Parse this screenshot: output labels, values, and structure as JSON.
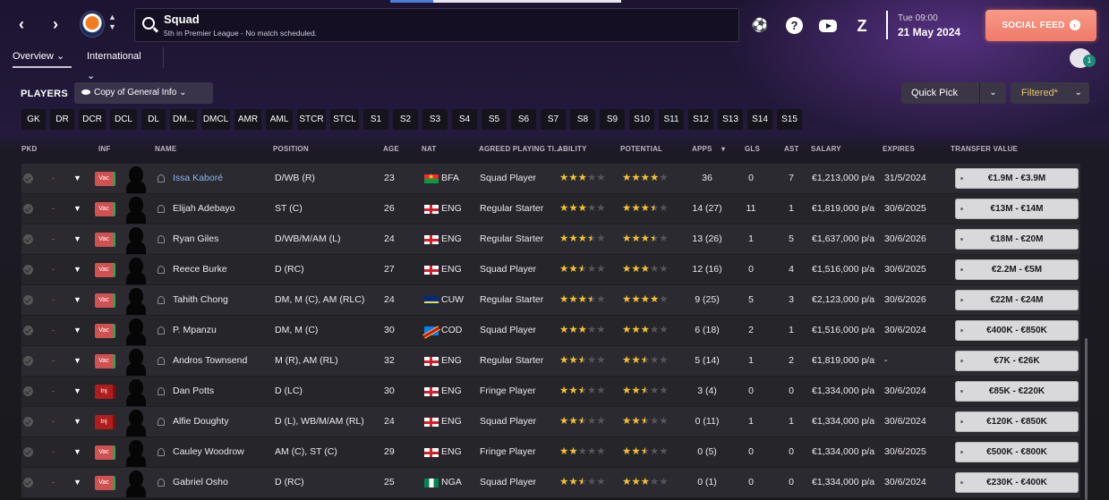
{
  "header": {
    "back_label": "‹",
    "forward_label": "›",
    "search_title": "Squad",
    "search_subtitle": "5th in Premier League - No match scheduled.",
    "date_day": "Tue 09:00",
    "date_full": "21 May 2024",
    "social_feed_label": "SOCIAL FEED"
  },
  "subnav": {
    "overview_label": "Overview",
    "international_label": "International",
    "user_badge": "1"
  },
  "players_bar": {
    "title": "PLAYERS",
    "view_label": "Copy of General Info",
    "quick_pick_label": "Quick Pick",
    "filtered_label": "Filtered*"
  },
  "position_filters": [
    "GK",
    "DR",
    "DCR",
    "DCL",
    "DL",
    "DM...",
    "DMCL",
    "AMR",
    "AML",
    "STCR",
    "STCL",
    "S1",
    "S2",
    "S3",
    "S4",
    "S5",
    "S6",
    "S7",
    "S8",
    "S9",
    "S10",
    "S11",
    "S12",
    "S13",
    "S14",
    "S15"
  ],
  "columns": {
    "pkd": "PKD",
    "inf": "INF",
    "name": "NAME",
    "position": "POSITION",
    "age": "AGE",
    "nat": "NAT",
    "agreed": "AGREED PLAYING TI...",
    "ability": "ABILITY",
    "potential": "POTENTIAL",
    "apps": "APPS",
    "gls": "GLS",
    "ast": "AST",
    "salary": "SALARY",
    "expires": "EXPIRES",
    "transfer_value": "TRANSFER VALUE"
  },
  "players": [
    {
      "name": "Issa Kaboré",
      "status": "Vac",
      "position": "D/WB (R)",
      "age": "23",
      "nat": "BFA",
      "flag": "bfa",
      "agreed": "Squad Player",
      "ability": 3,
      "potential": 4,
      "apps": "36",
      "gls": "0",
      "ast": "7",
      "salary": "€1,213,000 p/a",
      "expires": "31/5/2024",
      "value": "€1.9M - €3.9M"
    },
    {
      "name": "Elijah Adebayo",
      "status": "Vac",
      "position": "ST (C)",
      "age": "26",
      "nat": "ENG",
      "flag": "eng",
      "agreed": "Regular Starter",
      "ability": 3,
      "potential": 3.5,
      "apps": "14 (27)",
      "gls": "11",
      "ast": "1",
      "salary": "€1,819,000 p/a",
      "expires": "30/6/2025",
      "value": "€13M - €14M"
    },
    {
      "name": "Ryan Giles",
      "status": "Vac",
      "position": "D/WB/M/AM (L)",
      "age": "24",
      "nat": "ENG",
      "flag": "eng",
      "agreed": "Regular Starter",
      "ability": 3.5,
      "potential": 3.5,
      "apps": "13 (26)",
      "gls": "1",
      "ast": "5",
      "salary": "€1,637,000 p/a",
      "expires": "30/6/2026",
      "value": "€18M - €20M"
    },
    {
      "name": "Reece Burke",
      "status": "Vac",
      "position": "D (RC)",
      "age": "27",
      "nat": "ENG",
      "flag": "eng",
      "agreed": "Squad Player",
      "ability": 2.5,
      "potential": 3,
      "apps": "12 (16)",
      "gls": "0",
      "ast": "4",
      "salary": "€1,516,000 p/a",
      "expires": "30/6/2025",
      "value": "€2.2M - €5M"
    },
    {
      "name": "Tahith Chong",
      "status": "Vac",
      "position": "DM, M (C), AM (RLC)",
      "age": "24",
      "nat": "CUW",
      "flag": "cuw",
      "agreed": "Regular Starter",
      "ability": 3.5,
      "potential": 4,
      "apps": "9 (25)",
      "gls": "5",
      "ast": "3",
      "salary": "€2,123,000 p/a",
      "expires": "30/6/2026",
      "value": "€22M - €24M"
    },
    {
      "name": "P. Mpanzu",
      "status": "Vac",
      "position": "DM, M (C)",
      "age": "30",
      "nat": "COD",
      "flag": "cod",
      "agreed": "Squad Player",
      "ability": 3,
      "potential": 3,
      "apps": "6 (18)",
      "gls": "2",
      "ast": "1",
      "salary": "€1,516,000 p/a",
      "expires": "30/6/2024",
      "value": "€400K - €850K"
    },
    {
      "name": "Andros Townsend",
      "status": "Vac",
      "position": "M (R), AM (RL)",
      "age": "32",
      "nat": "ENG",
      "flag": "eng",
      "agreed": "Regular Starter",
      "ability": 2.5,
      "potential": 2.5,
      "apps": "5 (14)",
      "gls": "1",
      "ast": "2",
      "salary": "€1,819,000 p/a",
      "expires": "-",
      "value": "€7K - €26K"
    },
    {
      "name": "Dan Potts",
      "status": "Inj",
      "position": "D (LC)",
      "age": "30",
      "nat": "ENG",
      "flag": "eng",
      "agreed": "Fringe Player",
      "ability": 2.5,
      "potential": 2.5,
      "apps": "3 (4)",
      "gls": "0",
      "ast": "0",
      "salary": "€1,334,000 p/a",
      "expires": "30/6/2024",
      "value": "€85K - €220K"
    },
    {
      "name": "Alfie Doughty",
      "status": "Inj",
      "position": "D (L), WB/M/AM (RL)",
      "age": "24",
      "nat": "ENG",
      "flag": "eng",
      "agreed": "Squad Player",
      "ability": 2.5,
      "potential": 2.5,
      "apps": "0 (11)",
      "gls": "1",
      "ast": "1",
      "salary": "€1,334,000 p/a",
      "expires": "30/6/2024",
      "value": "€120K - €850K"
    },
    {
      "name": "Cauley Woodrow",
      "status": "Vac",
      "position": "AM (C), ST (C)",
      "age": "29",
      "nat": "ENG",
      "flag": "eng",
      "agreed": "Fringe Player",
      "ability": 2,
      "potential": 2.5,
      "apps": "0 (5)",
      "gls": "0",
      "ast": "0",
      "salary": "€1,334,000 p/a",
      "expires": "30/6/2025",
      "value": "€500K - €800K"
    },
    {
      "name": "Gabriel Osho",
      "status": "Vac",
      "position": "D (RC)",
      "age": "25",
      "nat": "NGA",
      "flag": "nga",
      "agreed": "Squad Player",
      "ability": 2.5,
      "potential": 3,
      "apps": "0 (1)",
      "gls": "0",
      "ast": "0",
      "salary": "€1,334,000 p/a",
      "expires": "30/6/2024",
      "value": "€230K - €400K"
    }
  ],
  "colors": {
    "accent_social": "#f07a68",
    "status_vac": "#d05151",
    "status_inj": "#b11d1d",
    "star": "#f2c233",
    "link": "#8fb4f0",
    "filtered": "#e6c46a"
  },
  "icons": {
    "back": "chevron-left-icon",
    "forward": "chevron-right-icon",
    "search": "search-icon",
    "football": "football-icon",
    "help": "help-icon",
    "youtube": "youtube-icon",
    "zendesk": "z-icon",
    "social_go": "chevron-circle-icon"
  }
}
